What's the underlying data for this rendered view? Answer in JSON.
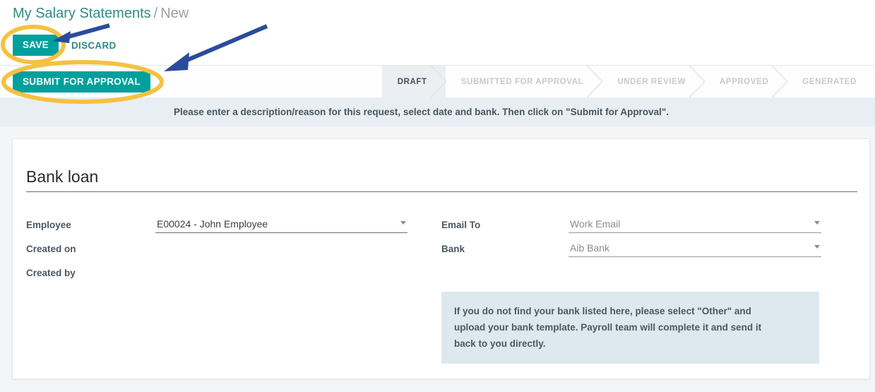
{
  "breadcrumb": {
    "root": "My Salary Statements",
    "separator": "/",
    "current": "New"
  },
  "toolbar": {
    "save_label": "SAVE",
    "discard_label": "DISCARD",
    "submit_label": "SUBMIT FOR APPROVAL"
  },
  "statusbar": {
    "stages": [
      {
        "label": "DRAFT",
        "active": true
      },
      {
        "label": "SUBMITTED FOR APPROVAL",
        "active": false
      },
      {
        "label": "UNDER REVIEW",
        "active": false
      },
      {
        "label": "APPROVED",
        "active": false
      },
      {
        "label": "GENERATED",
        "active": false
      }
    ]
  },
  "alert": {
    "message": "Please enter a description/reason for this request, select date and bank. Then click on \"Submit for Approval\"."
  },
  "record": {
    "title": "Bank loan",
    "fields_left": [
      {
        "label": "Employee",
        "value": "E00024 - John Employee",
        "placeholder": "",
        "muted": false,
        "has_dropdown": true
      },
      {
        "label": "Created on",
        "value": "",
        "placeholder": "",
        "muted": false,
        "has_dropdown": false
      },
      {
        "label": "Created by",
        "value": "",
        "placeholder": "",
        "muted": false,
        "has_dropdown": false
      }
    ],
    "fields_right": [
      {
        "label": "Email To",
        "value": "Work Email",
        "placeholder": "Work Email",
        "muted": true,
        "has_dropdown": true
      },
      {
        "label": "Bank",
        "value": "Aib Bank",
        "placeholder": "Aib Bank",
        "muted": true,
        "has_dropdown": true
      }
    ]
  },
  "info_box": {
    "line1": "If you do not find your bank listed here, please select \"Other\" and",
    "line2": "upload your bank template. Payroll team will complete it and send it",
    "line3": "back to you directly."
  },
  "colors": {
    "accent_teal": "#00a09d",
    "breadcrumb_link": "#2e8b86",
    "annotation_yellow": "#f5c142",
    "annotation_blue": "#2b4b9b",
    "alert_bg": "#e8eff4",
    "info_bg": "#dde8ef",
    "page_bg": "#f4f5f6"
  }
}
